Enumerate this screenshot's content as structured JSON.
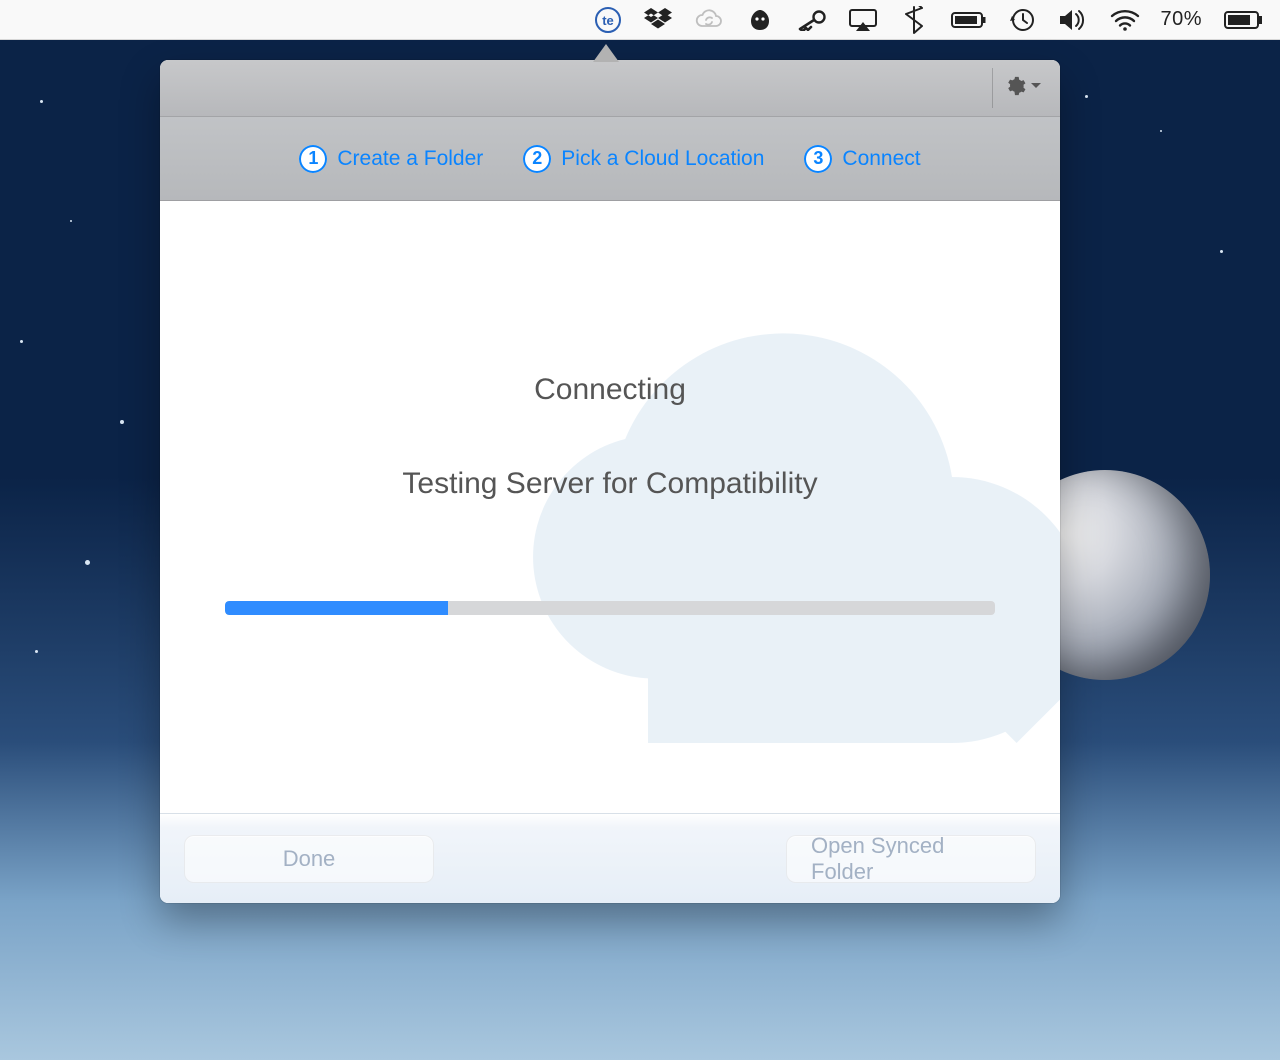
{
  "menubar": {
    "battery_percent": "70%",
    "icons": [
      "te-icon",
      "dropbox-icon",
      "cloud-sync-icon",
      "freckle-icon",
      "key-icon",
      "airplay-icon",
      "bluetooth-icon",
      "keyboard-battery-icon",
      "timemachine-icon",
      "volume-icon",
      "wifi-icon"
    ]
  },
  "popover": {
    "settings_label": "Settings",
    "steps": [
      {
        "num": "1",
        "label": "Create a Folder"
      },
      {
        "num": "2",
        "label": "Pick a Cloud Location"
      },
      {
        "num": "3",
        "label": "Connect"
      }
    ],
    "status_title": "Connecting",
    "status_detail": "Testing Server for Compatibility",
    "progress_percent": 29,
    "footer": {
      "done_label": "Done",
      "open_label": "Open Synced Folder"
    }
  }
}
